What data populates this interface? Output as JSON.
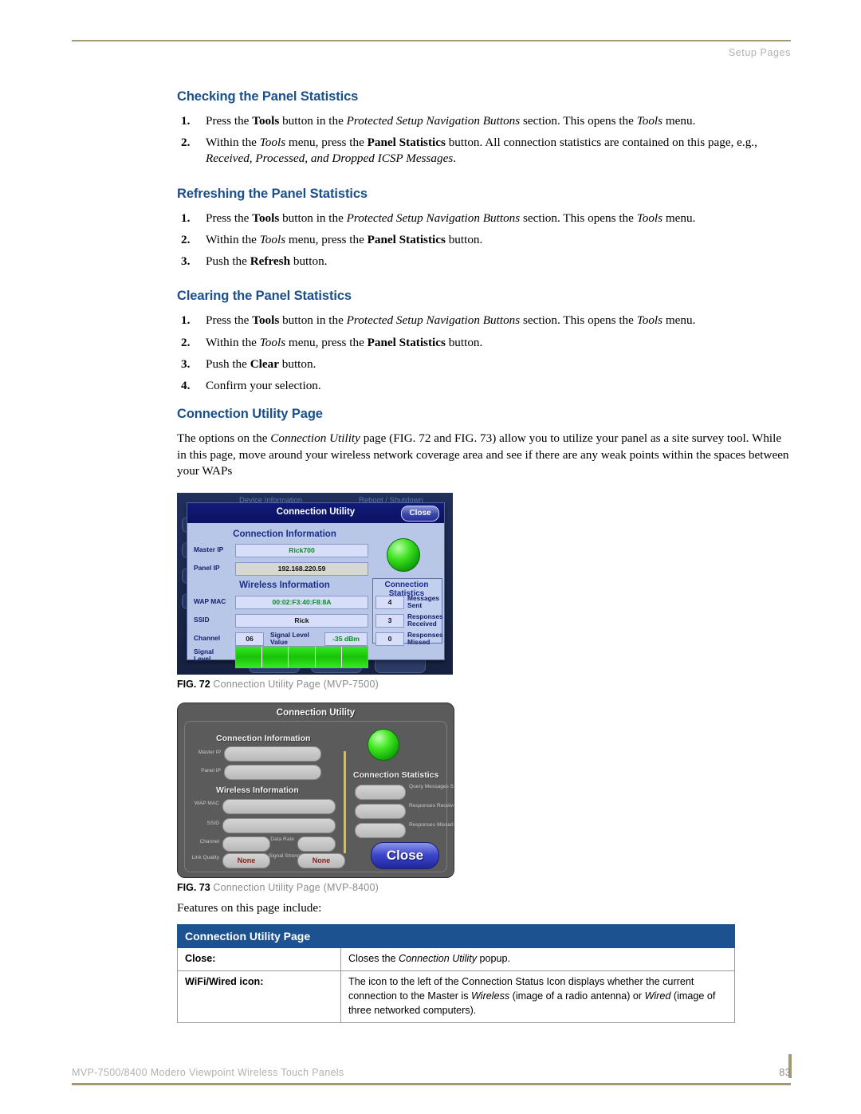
{
  "header": {
    "running_head": "Setup Pages"
  },
  "footer": {
    "doc_title": "MVP-7500/8400 Modero Viewpoint Wireless Touch Panels",
    "page_number": "83"
  },
  "sections": [
    {
      "heading": "Checking the Panel Statistics",
      "steps": [
        {
          "num": "1.",
          "text": "Press the Tools button in the Protected Setup Navigation Buttons section. This opens the Tools menu."
        },
        {
          "num": "2.",
          "text": "Within the Tools menu, press the Panel Statistics button. All connection statistics are contained on this page, e.g., Received, Processed, and Dropped ICSP Messages."
        }
      ]
    },
    {
      "heading": "Refreshing the Panel Statistics",
      "steps": [
        {
          "num": "1.",
          "text": "Press the Tools button in the Protected Setup Navigation Buttons section. This opens the Tools menu."
        },
        {
          "num": "2.",
          "text": "Within the Tools menu, press the Panel Statistics button."
        },
        {
          "num": "3.",
          "text": "Push the Refresh button."
        }
      ]
    },
    {
      "heading": "Clearing the Panel Statistics",
      "steps": [
        {
          "num": "1.",
          "text": "Press the Tools button in the Protected Setup Navigation Buttons section. This opens the Tools menu."
        },
        {
          "num": "2.",
          "text": "Within the Tools menu, press the Panel Statistics button."
        },
        {
          "num": "3.",
          "text": "Push the Clear button."
        },
        {
          "num": "4.",
          "text": "Confirm your selection."
        }
      ]
    }
  ],
  "connection_utility": {
    "heading": "Connection Utility Page",
    "intro": "The options on the Connection Utility page (FIG. 72 and FIG. 73) allow you to utilize your panel as a site survey tool. While in this page, move around your wireless network coverage area and see if there are any weak points within the spaces between your WAPs",
    "features_lead": "Features on this page include:"
  },
  "fig72": {
    "label": "FIG. 72",
    "caption": "Connection Utility Page (MVP-7500)",
    "background": {
      "device_information": "Device Information",
      "reboot_shutdown": "Reboot / Shutdown"
    },
    "dialog": {
      "title": "Connection Utility",
      "close": "Close",
      "connection_information": "Connection Information",
      "master_ip_label": "Master IP",
      "master_ip_value": "Rick700",
      "panel_ip_label": "Panel IP",
      "panel_ip_value": "192.168.220.59",
      "wireless_information": "Wireless Information",
      "wap_mac_label": "WAP MAC",
      "wap_mac_value": "00:02:F3:40:F8:8A",
      "ssid_label": "SSID",
      "ssid_value": "Rick",
      "channel_label": "Channel",
      "channel_value": "06",
      "signal_level_value_label": "Signal Level Value",
      "signal_level_value": "-35 dBm",
      "signal_level_label": "Signal Level",
      "connection_statistics": "Connection Statistics",
      "messages_sent_label": "Messages Sent",
      "messages_sent_value": "4",
      "responses_received_label": "Responses Received",
      "responses_received_value": "3",
      "responses_missed_label": "Responses Missed",
      "responses_missed_value": "0"
    }
  },
  "fig73": {
    "label": "FIG. 73",
    "caption": "Connection Utility Page (MVP-8400)",
    "dialog": {
      "title": "Connection Utility",
      "connection_information": "Connection Information",
      "master_ip_label": "Master IP",
      "panel_ip_label": "Panel IP",
      "wireless_information": "Wireless Information",
      "wap_mac_label": "WAP MAC",
      "ssid_label": "SSID",
      "channel_label": "Channel",
      "data_rate_label": "Data Rate",
      "link_quality_label": "Link Quality",
      "link_quality_value": "None",
      "signal_strength_label": "Signal Strength",
      "signal_strength_value": "None",
      "connection_statistics": "Connection Statistics",
      "query_messages_sent_label": "Query Messages Sent",
      "responses_received_label": "Responses Received",
      "responses_missed_label": "Responses Missed",
      "close": "Close"
    }
  },
  "feature_table": {
    "header": "Connection Utility Page",
    "rows": [
      {
        "key": "Close:",
        "value": "Closes the Connection Utility popup."
      },
      {
        "key": "WiFi/Wired icon:",
        "value": "The icon to the left of the Connection Status Icon displays whether the current connection to the Master is Wireless (image of a radio antenna) or Wired (image of three networked computers)."
      }
    ]
  },
  "colors": {
    "heading_blue": "#1a4f8c",
    "table_header_blue": "#1d5290",
    "rule_tan": "#a39a72",
    "led_green": "#2ecc16"
  }
}
